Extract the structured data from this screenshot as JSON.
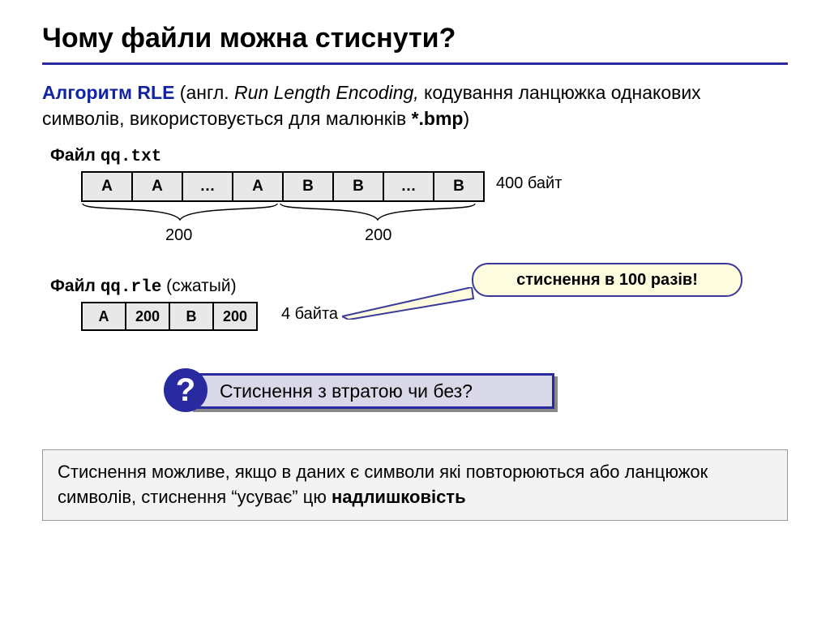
{
  "title": "Чому файли можна стиснути?",
  "intro": {
    "lead": "Алгоритм RLE",
    "paren_open": " (англ. ",
    "em": "Run Length Encoding,",
    "rest1": " кодування ланцюжка однакових символів, використовується для малюнків ",
    "bmp": "*.bmp",
    "close": ")"
  },
  "file1": {
    "label": "Файл ",
    "name": "qq.txt"
  },
  "table1": [
    "A",
    "A",
    "…",
    "A",
    "B",
    "B",
    "…",
    "B"
  ],
  "size1": "400 байт",
  "brace1": "200",
  "brace2": "200",
  "file2": {
    "label": "Файл ",
    "name": "qq.rle",
    "suffix": "  (сжатый)"
  },
  "table2": [
    "A",
    "200",
    "B",
    "200"
  ],
  "size2": "4 байта",
  "callout": "стиснення в 100 разів!",
  "question_mark": "?",
  "question": "Стиснення з втратою чи без?",
  "summary": {
    "t1": "Стиснення можливе, якщо в даних є символи які повторюються або ланцюжок символів, стиснення “усуває” цю ",
    "bold": "надлишковість"
  }
}
